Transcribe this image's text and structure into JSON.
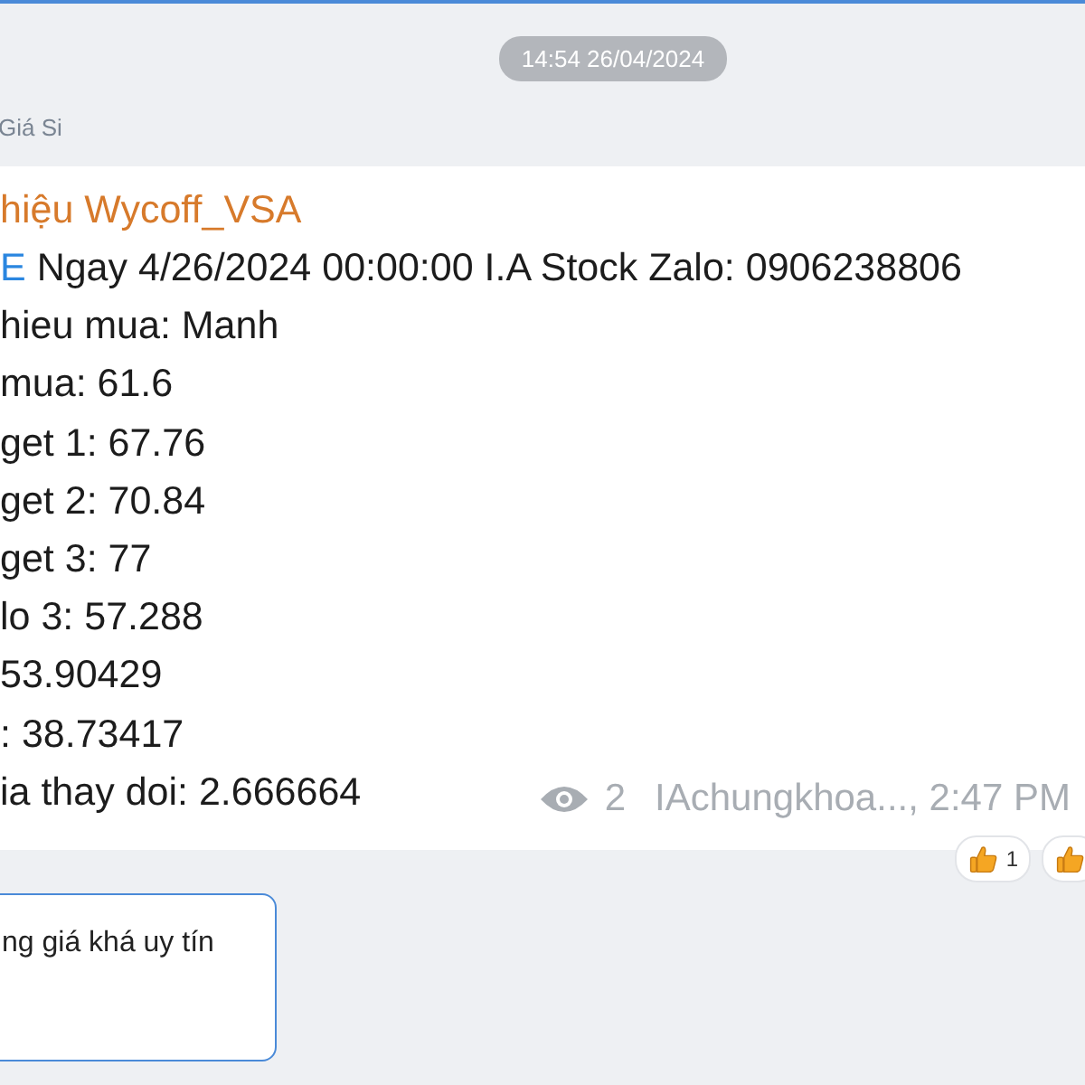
{
  "date_divider": "14:54 26/04/2024",
  "sender_name": "Giá Si",
  "message": {
    "title": "hiệu Wycoff_VSA",
    "lines": [
      {
        "prefix": "E",
        "text": "Ngay 4/26/2024 00:00:00 I.A Stock Zalo: 0906238806"
      },
      {
        "text": "hieu mua: Manh"
      },
      {
        "text": "mua: 61.6"
      },
      {
        "text": "get 1: 67.76"
      },
      {
        "text": "get 2: 70.84"
      },
      {
        "text": "get 3: 77"
      },
      {
        "text": "lo 3: 57.288"
      },
      {
        "text": "53.90429"
      },
      {
        "text": ": 38.73417"
      },
      {
        "text": "ia thay doi: 2.666664"
      }
    ],
    "views": "2",
    "meta": "IAchungkhoa..., 2:47 PM",
    "reactions": [
      {
        "kind": "thumbs-up",
        "count": "1"
      },
      {
        "kind": "thumbs-up"
      }
    ]
  },
  "reply_card": {
    "text": "ng giá khá uy tín"
  }
}
